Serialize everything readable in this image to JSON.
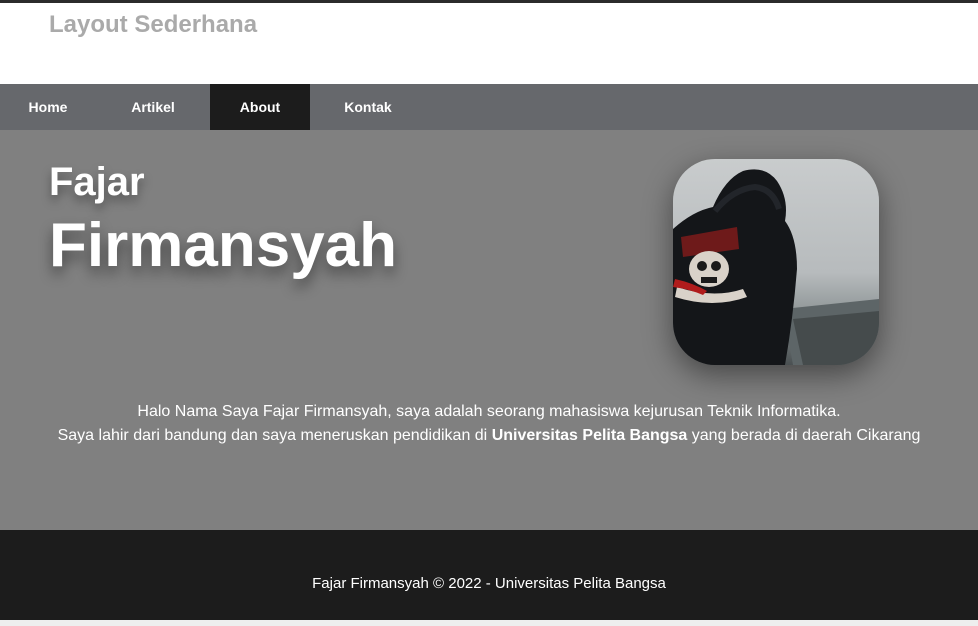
{
  "header": {
    "title": "Layout Sederhana"
  },
  "nav": {
    "items": [
      {
        "label": "Home"
      },
      {
        "label": "Artikel"
      },
      {
        "label": "About"
      },
      {
        "label": "Kontak"
      }
    ],
    "active": "About"
  },
  "hero": {
    "first_name": "Fajar",
    "last_name": "Firmansyah",
    "photo_icon": "profile-photo-hooded-person"
  },
  "bio": {
    "line1": "Halo Nama Saya Fajar Firmansyah, saya adalah seorang mahasiswa kejurusan Teknik Informatika.",
    "line2_before": "Saya lahir dari bandung dan saya meneruskan pendidikan di ",
    "line2_bold": "Universitas Pelita Bangsa",
    "line2_after": " yang berada di daerah Cikarang"
  },
  "footer": {
    "text": "Fajar Firmansyah © 2022 - Universitas Pelita Bangsa"
  },
  "colors": {
    "nav_bg": "#66686c",
    "nav_active": "#1c1c1c",
    "hero_bg": "#808080",
    "footer_bg": "#1c1c1c",
    "title_color": "#aaaaaa"
  }
}
